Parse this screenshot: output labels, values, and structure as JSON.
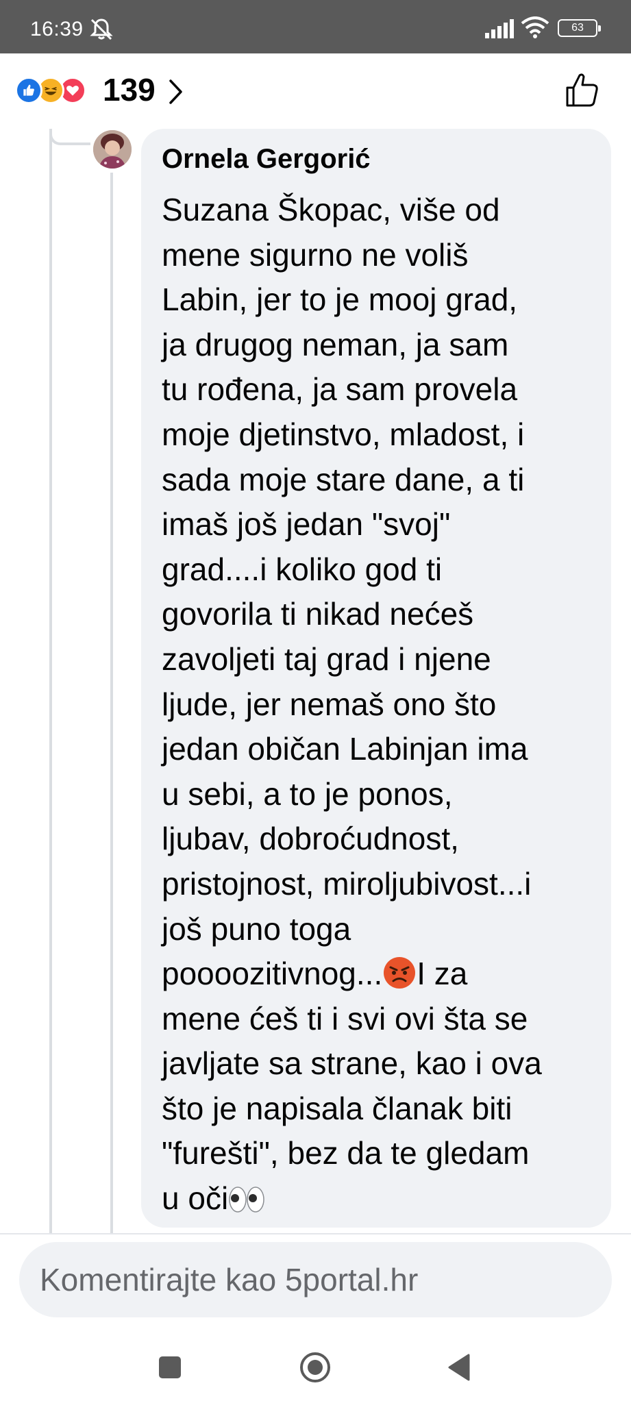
{
  "status_bar": {
    "time": "16:39",
    "battery": "63",
    "icons": [
      "mute-icon",
      "signal-icon",
      "wifi-icon",
      "battery-icon"
    ]
  },
  "reactions": {
    "icons": [
      "like-reaction-icon",
      "haha-reaction-icon",
      "love-reaction-icon"
    ],
    "count": "139"
  },
  "comment": {
    "author": "Ornela Gergorić",
    "text_part1": "Suzana Škopac, više od\nmene sigurno ne voliš\nLabin, jer to je mooj grad,\nja drugog neman, ja sam\ntu rođena, ja sam provela\nmoje djetinstvo, mladost, i\nsada moje stare dane, a ti\nimaš još jedan \"svoj\"\ngrad....i koliko god ti\ngovorila ti nikad nećeš\nzavoljeti taj grad i njene\nljude, jer nemaš ono što\njedan običan Labinjan ima\nu sebi, a to je ponos,\nljubav, dobroćudnost,\npristojnost, miroljubivost...i\njoš puno toga\npoooozitivnog...",
    "text_part2": "I za\nmene ćeš ti i svi ovi šta se\njavljate sa strane, kao i ova\nšto je napisala članak biti\n\"furešti\", bez da te gledam\nu oči",
    "emoji_angry": "angry-face-icon",
    "emoji_eyes": "eyes-icon"
  },
  "composer": {
    "placeholder": "Komentirajte kao 5portal.hr"
  },
  "colors": {
    "status_bar": "#5a5a5a",
    "bubble": "#f0f2f5",
    "like_blue": "#1b74e4",
    "love_red": "#f33e58",
    "haha_yellow": "#f7b125"
  }
}
